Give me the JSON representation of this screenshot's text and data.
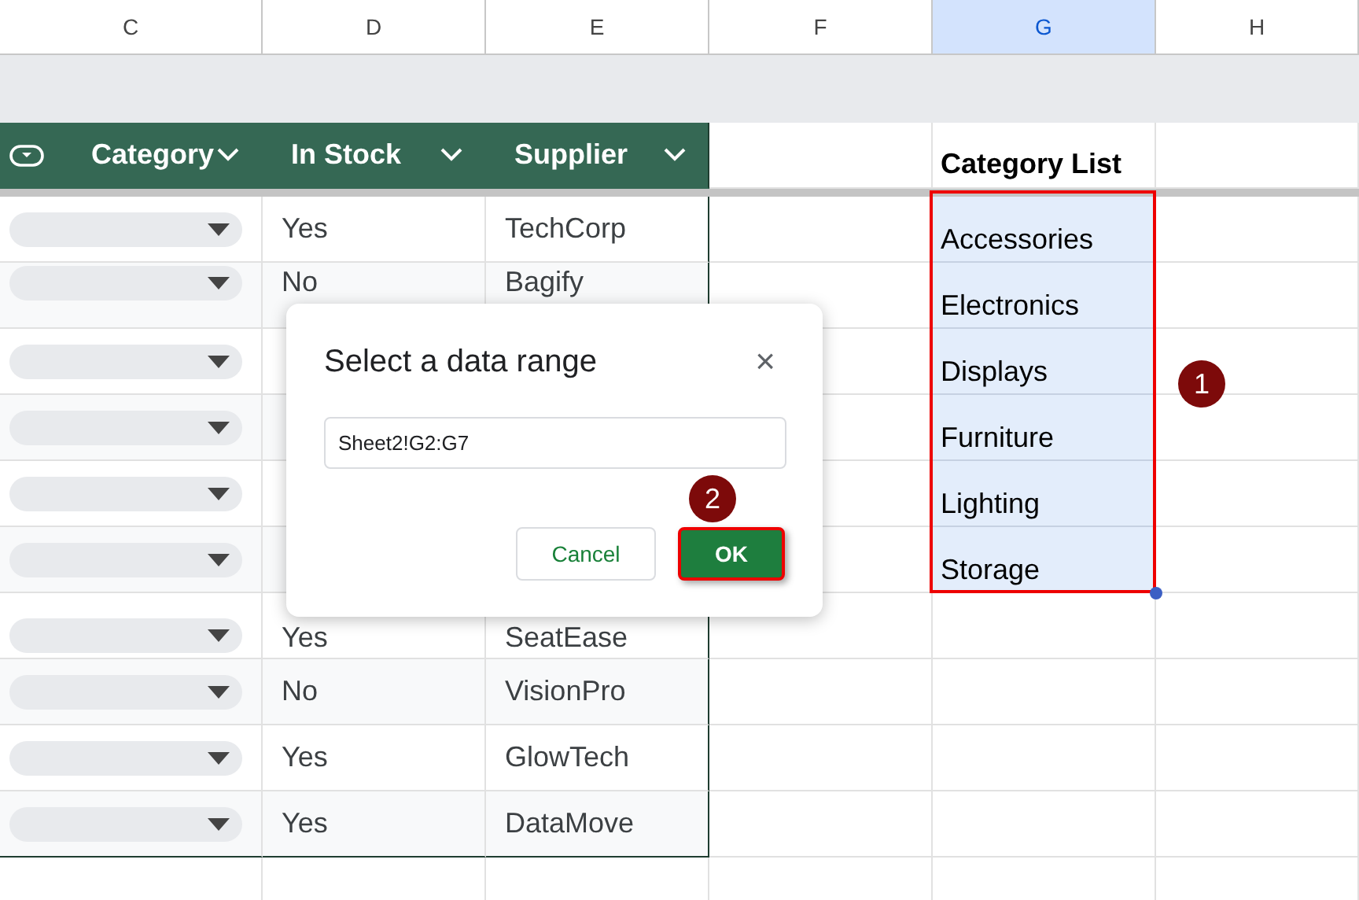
{
  "column_headers": [
    {
      "label": "C",
      "selected": false
    },
    {
      "label": "D",
      "selected": false
    },
    {
      "label": "E",
      "selected": false
    },
    {
      "label": "F",
      "selected": false
    },
    {
      "label": "G",
      "selected": true
    },
    {
      "label": "H",
      "selected": false
    }
  ],
  "table": {
    "columns": [
      {
        "label": "Category"
      },
      {
        "label": "In Stock"
      },
      {
        "label": "Supplier"
      }
    ],
    "rows": [
      {
        "in_stock": "Yes",
        "supplier": "TechCorp"
      },
      {
        "in_stock": "No",
        "supplier": "Bagify"
      },
      {},
      {},
      {},
      {},
      {
        "in_stock": "Yes",
        "supplier": "SeatEase"
      },
      {
        "in_stock": "No",
        "supplier": "VisionPro"
      },
      {
        "in_stock": "Yes",
        "supplier": "GlowTech"
      },
      {
        "in_stock": "Yes",
        "supplier": "DataMove"
      }
    ]
  },
  "category_list": {
    "title": "Category List",
    "items": [
      {
        "label": "Accessories",
        "selected": true
      },
      {
        "label": "Electronics",
        "selected": true
      },
      {
        "label": "Displays",
        "selected": true
      },
      {
        "label": "Furniture",
        "selected": true
      },
      {
        "label": "Lighting",
        "selected": true
      },
      {
        "label": "Storage",
        "selected": true
      }
    ]
  },
  "dialog": {
    "title": "Select a data range",
    "close": "×",
    "range": "Sheet2!G2:G7",
    "buttons": [
      {
        "label": "Cancel",
        "kind": "secondary"
      },
      {
        "label": "OK",
        "kind": "primary"
      }
    ]
  },
  "callouts": [
    {
      "label": "1"
    },
    {
      "label": "2"
    }
  ]
}
